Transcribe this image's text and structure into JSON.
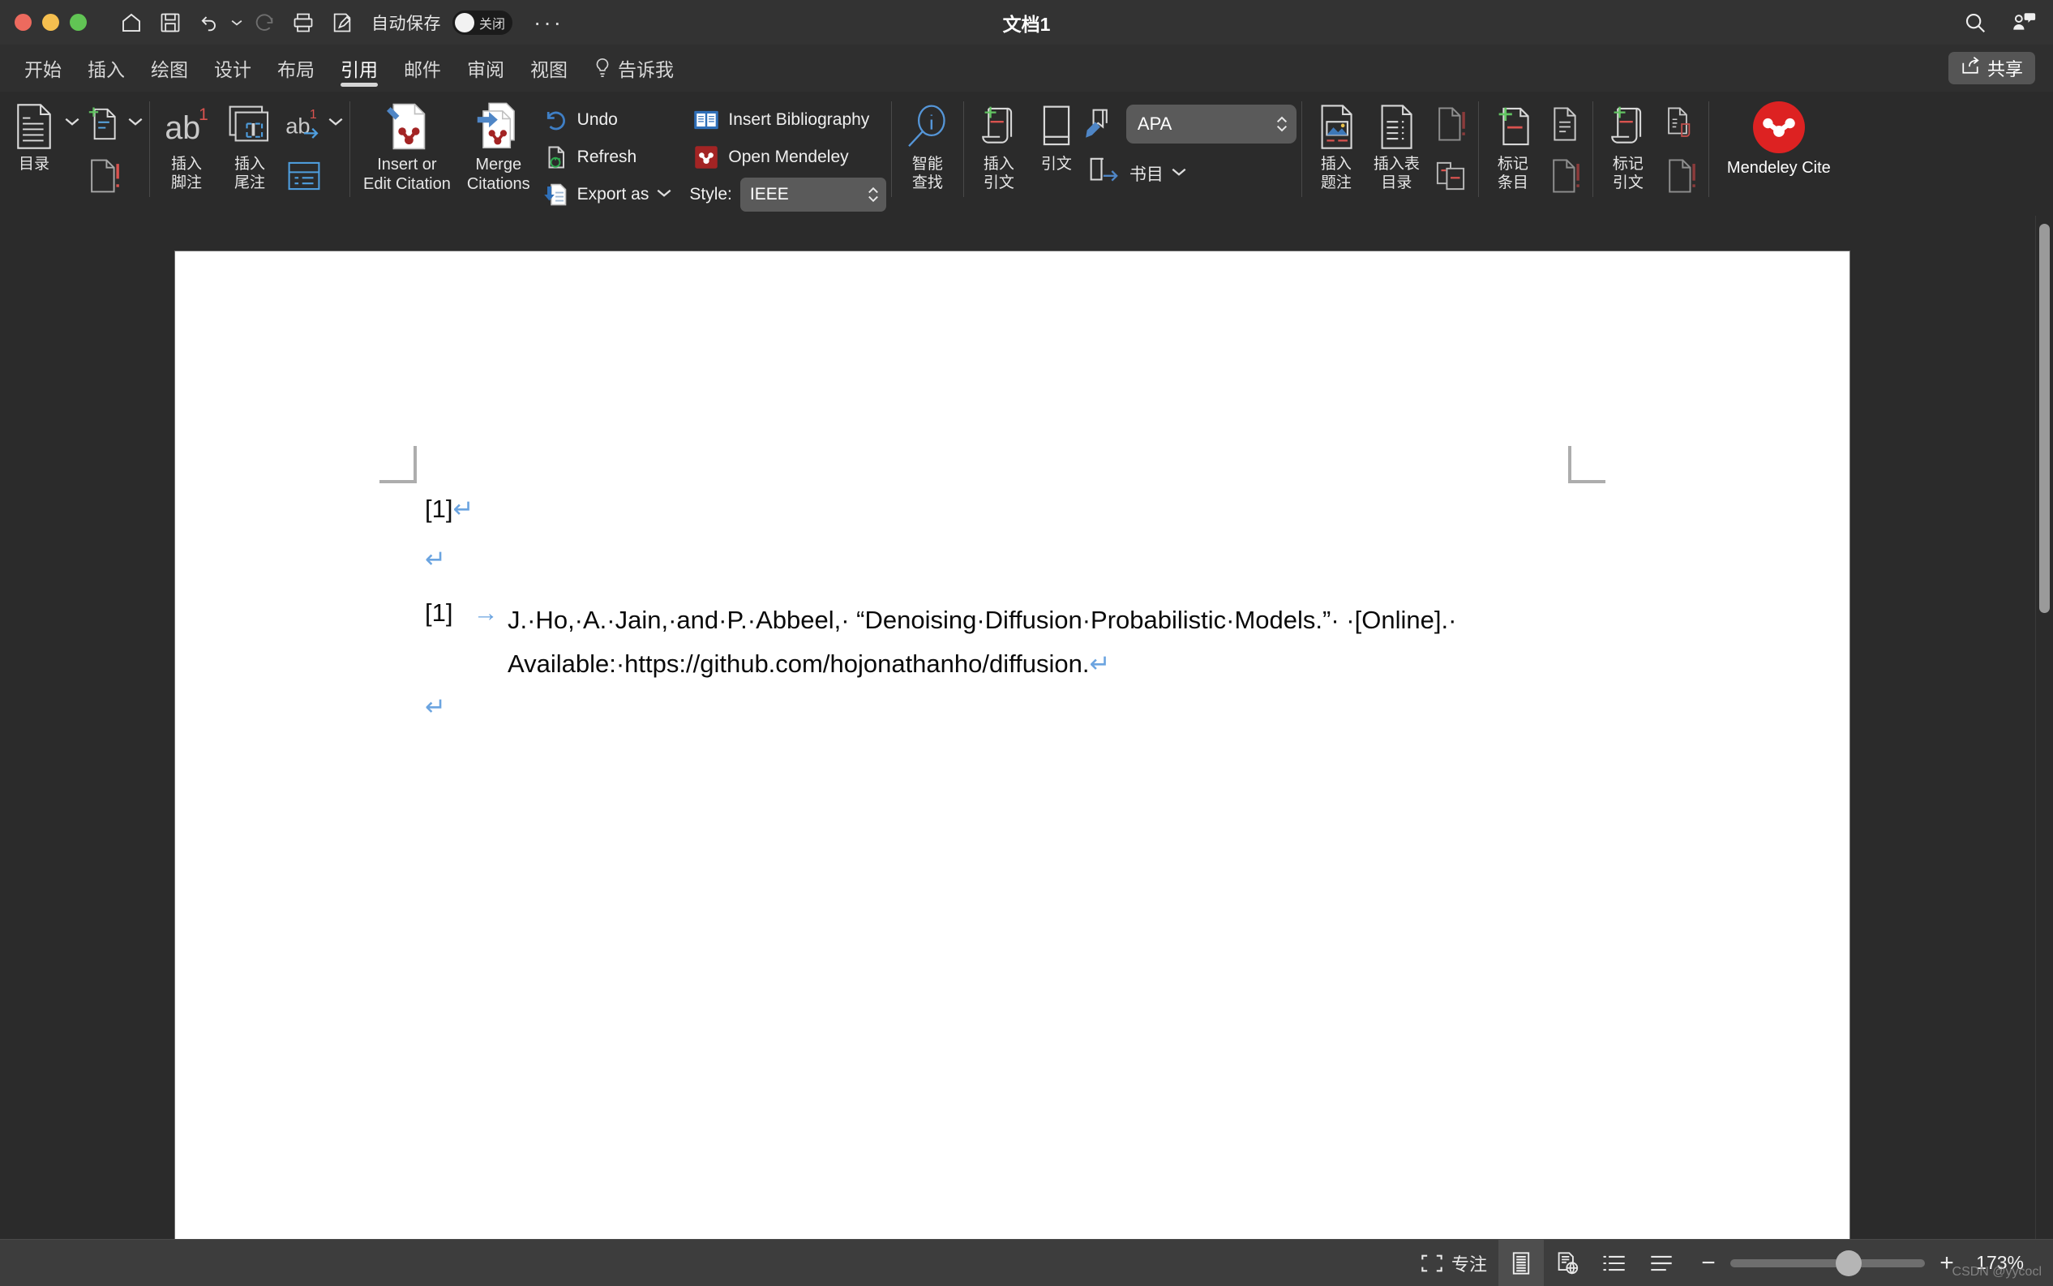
{
  "window": {
    "title": "文档1",
    "traffic_lights": [
      "close",
      "minimize",
      "maximize"
    ],
    "autosave_label": "自动保存",
    "autosave_state": "关闭",
    "overflow_label": "···"
  },
  "quick_access": [
    {
      "name": "home-icon",
      "label": "Home"
    },
    {
      "name": "save-icon",
      "label": "Save"
    },
    {
      "name": "undo-icon",
      "label": "Undo"
    },
    {
      "name": "undo-dropdown-caret-icon",
      "label": "Undo options"
    },
    {
      "name": "redo-icon",
      "label": "Redo"
    },
    {
      "name": "print-icon",
      "label": "Print"
    },
    {
      "name": "edit-doc-icon",
      "label": "Edit"
    }
  ],
  "title_right": [
    {
      "name": "search-icon",
      "label": "搜索"
    },
    {
      "name": "comment-person-icon",
      "label": "批注"
    }
  ],
  "tabs": [
    {
      "label": "开始",
      "active": false
    },
    {
      "label": "插入",
      "active": false
    },
    {
      "label": "绘图",
      "active": false
    },
    {
      "label": "设计",
      "active": false
    },
    {
      "label": "布局",
      "active": false
    },
    {
      "label": "引用",
      "active": true
    },
    {
      "label": "邮件",
      "active": false
    },
    {
      "label": "审阅",
      "active": false
    },
    {
      "label": "视图",
      "active": false
    },
    {
      "label": "告诉我",
      "active": false
    }
  ],
  "share_button": {
    "label": "共享",
    "icon": "share-icon"
  },
  "ribbon": {
    "group_toc": {
      "toc_button": {
        "label": "目录",
        "icon": "toc-doc-icon"
      },
      "update_toc_icon": "update-toc-icon",
      "add_text_icon": "add-text-doc-icon"
    },
    "group_footnotes": {
      "insert_footnote": {
        "label": "插入\n脚注",
        "icon": "footnote-ab-icon"
      },
      "insert_endnote": {
        "label": "插入\n尾注",
        "icon": "endnote-icon"
      },
      "next_footnote": {
        "label": "",
        "icon": "next-footnote-ab-icon"
      },
      "show_notes_icon": "show-notes-icon"
    },
    "group_mendeley": {
      "insert_or_edit_citation": {
        "label": "Insert or\nEdit Citation",
        "icon": "mendeley-insert-citation-icon"
      },
      "merge_citations": {
        "label": "Merge\nCitations",
        "icon": "mendeley-merge-citations-icon"
      },
      "undo": {
        "label": "Undo",
        "icon": "mendeley-undo-icon"
      },
      "refresh": {
        "label": "Refresh",
        "icon": "mendeley-refresh-icon"
      },
      "export_as": {
        "label": "Export as",
        "icon": "mendeley-export-icon"
      },
      "insert_bibliography": {
        "label": "Insert Bibliography",
        "icon": "bibliography-book-icon"
      },
      "open_mendeley": {
        "label": "Open Mendeley",
        "icon": "mendeley-logo-icon"
      },
      "style_label": "Style:",
      "style_value": "IEEE"
    },
    "group_smartlookup": {
      "smart_lookup": {
        "label": "智能\n查找",
        "icon": "smart-lookup-magnifier-icon"
      }
    },
    "group_citations": {
      "insert_citation": {
        "label": "插入\n引文",
        "icon": "insert-citation-icon"
      },
      "citation": {
        "label": "引文",
        "icon": "citation-book-icon"
      },
      "style_value": "APA",
      "bibliography": {
        "label": "书目",
        "icon": "bibliography-icon"
      },
      "manage_sources_icon": "manage-sources-icon"
    },
    "group_captions": {
      "insert_caption": {
        "label": "插入\n题注",
        "icon": "insert-caption-icon"
      },
      "insert_table_of_figures": {
        "label": "插入表\n目录",
        "icon": "insert-table-of-figures-icon"
      },
      "update_table_icon": "update-table-icon",
      "cross_reference_icon": "cross-reference-icon"
    },
    "group_index": {
      "mark_entry": {
        "label": "标记\n条目",
        "icon": "mark-entry-icon"
      },
      "insert_index_icon": "insert-index-icon",
      "update_index_icon": "update-index-icon"
    },
    "group_authorities": {
      "mark_citation": {
        "label": "标记\n引文",
        "icon": "mark-citation-icon"
      },
      "insert_table_of_authorities_icon": "insert-table-of-authorities-icon",
      "update_table_of_authorities_icon": "update-table-of-authorities-icon"
    },
    "group_mendeley_cite": {
      "label": "Mendeley\nCite",
      "icon": "mendeley-cite-logo-icon",
      "brand_color": "#dd2222"
    }
  },
  "document": {
    "citation_marker": "[1]",
    "reference": {
      "number": "[1]",
      "tab_arrow": "→",
      "line1": "J.·Ho,·A.·Jain,·and·P.·Abbeel,·  “Denoising·Diffusion·Probabilistic·Models.”·  ·[Online].·",
      "line2": "Available:·https://github.com/hojonathanho/diffusion."
    },
    "paragraph_mark": "↵"
  },
  "statusbar": {
    "focus": {
      "label": "专注",
      "icon": "focus-mode-icon"
    },
    "print_layout": {
      "label": "",
      "icon": "print-layout-icon",
      "selected": true
    },
    "web_layout": {
      "label": "",
      "icon": "web-layout-icon"
    },
    "outline": {
      "label": "",
      "icon": "outline-view-icon"
    },
    "draft": {
      "label": "",
      "icon": "draft-view-icon"
    },
    "zoom_out": "−",
    "zoom_in": "+",
    "zoom_value": "173%",
    "watermark": "CSDN @yycocl"
  }
}
